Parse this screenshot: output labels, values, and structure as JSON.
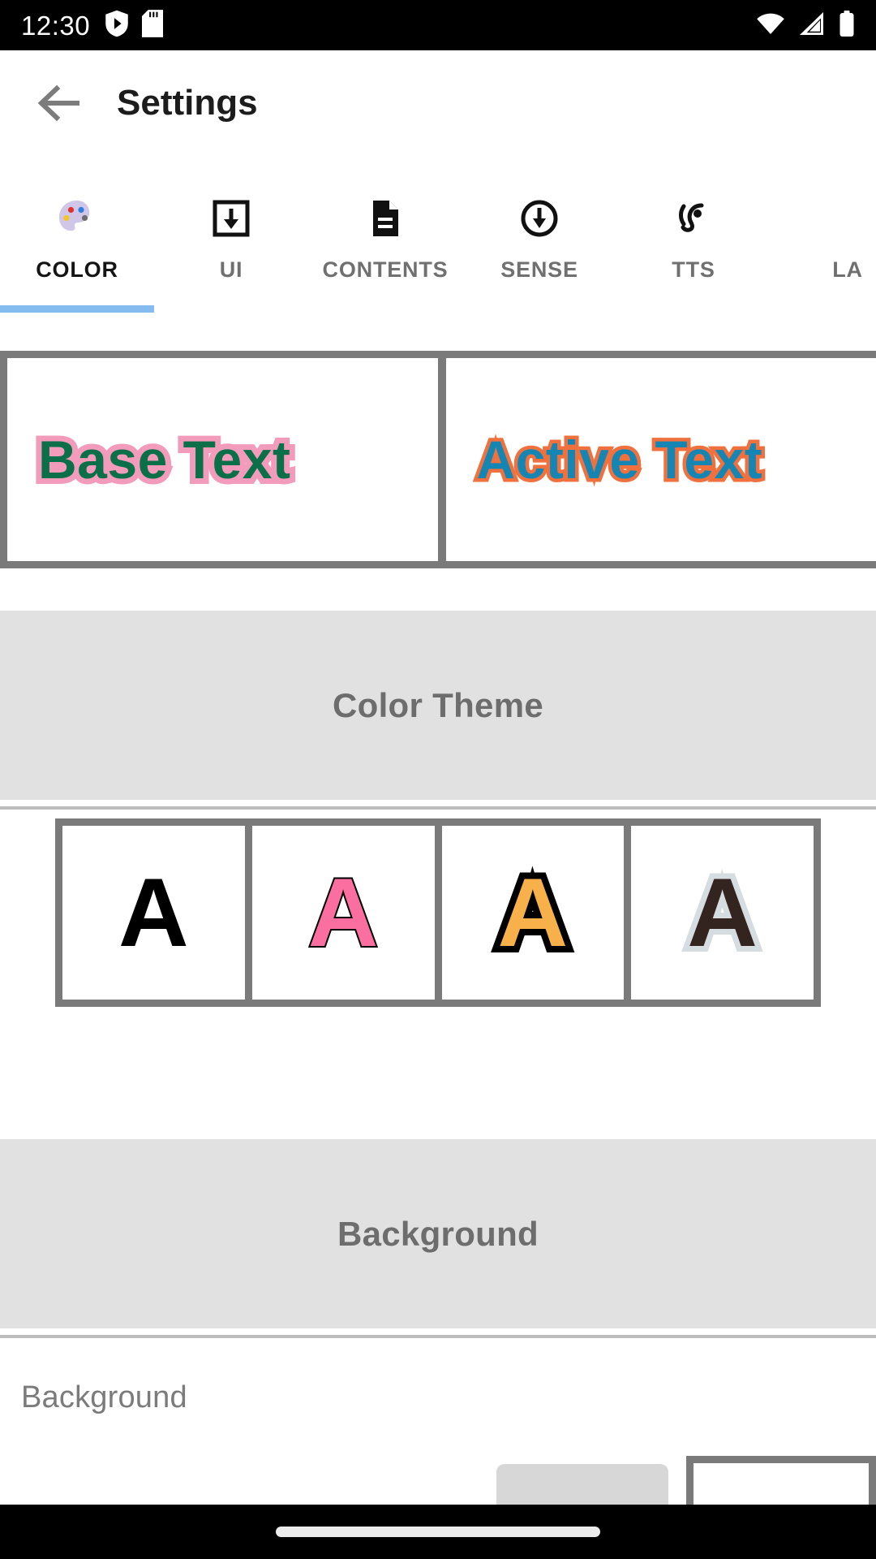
{
  "status_bar": {
    "time": "12:30",
    "left_icons": [
      "shield-play-icon",
      "sd-card-icon"
    ],
    "right_icons": [
      "wifi-icon",
      "cellular-signal-icon",
      "battery-icon"
    ]
  },
  "app_bar": {
    "back_icon": "arrow-back-icon",
    "title": "Settings"
  },
  "tabs": {
    "active_index": 0,
    "items": [
      {
        "label": "COLOR",
        "icon": "palette-icon"
      },
      {
        "label": "UI",
        "icon": "download-box-icon"
      },
      {
        "label": "CONTENTS",
        "icon": "document-icon"
      },
      {
        "label": "SENSE",
        "icon": "download-circle-icon"
      },
      {
        "label": "TTS",
        "icon": "hearing-ear-icon"
      },
      {
        "label": "LA",
        "icon": "language-icon"
      }
    ],
    "indicator_color": "#85bcf0"
  },
  "preview": {
    "base": {
      "text": "Base Text",
      "fill_color": "#0b7049",
      "stroke_color": "#f39bbb"
    },
    "active": {
      "text": "Active Text",
      "fill_color": "#1586b4",
      "stroke_color": "#f0713d"
    }
  },
  "color_theme": {
    "header": "Color Theme",
    "swatches": [
      {
        "glyph": "A",
        "name": "theme-black",
        "fill": "#000000",
        "stroke": "none"
      },
      {
        "glyph": "A",
        "name": "theme-pink",
        "fill": "#fa6ea0",
        "stroke": "#000000"
      },
      {
        "glyph": "A",
        "name": "theme-amber",
        "fill": "#f7b04a",
        "stroke": "#000000"
      },
      {
        "glyph": "A",
        "name": "theme-sepia",
        "fill": "#33241f",
        "stroke": "#d5dde1"
      }
    ]
  },
  "background": {
    "header": "Background",
    "row_label": "Background"
  }
}
